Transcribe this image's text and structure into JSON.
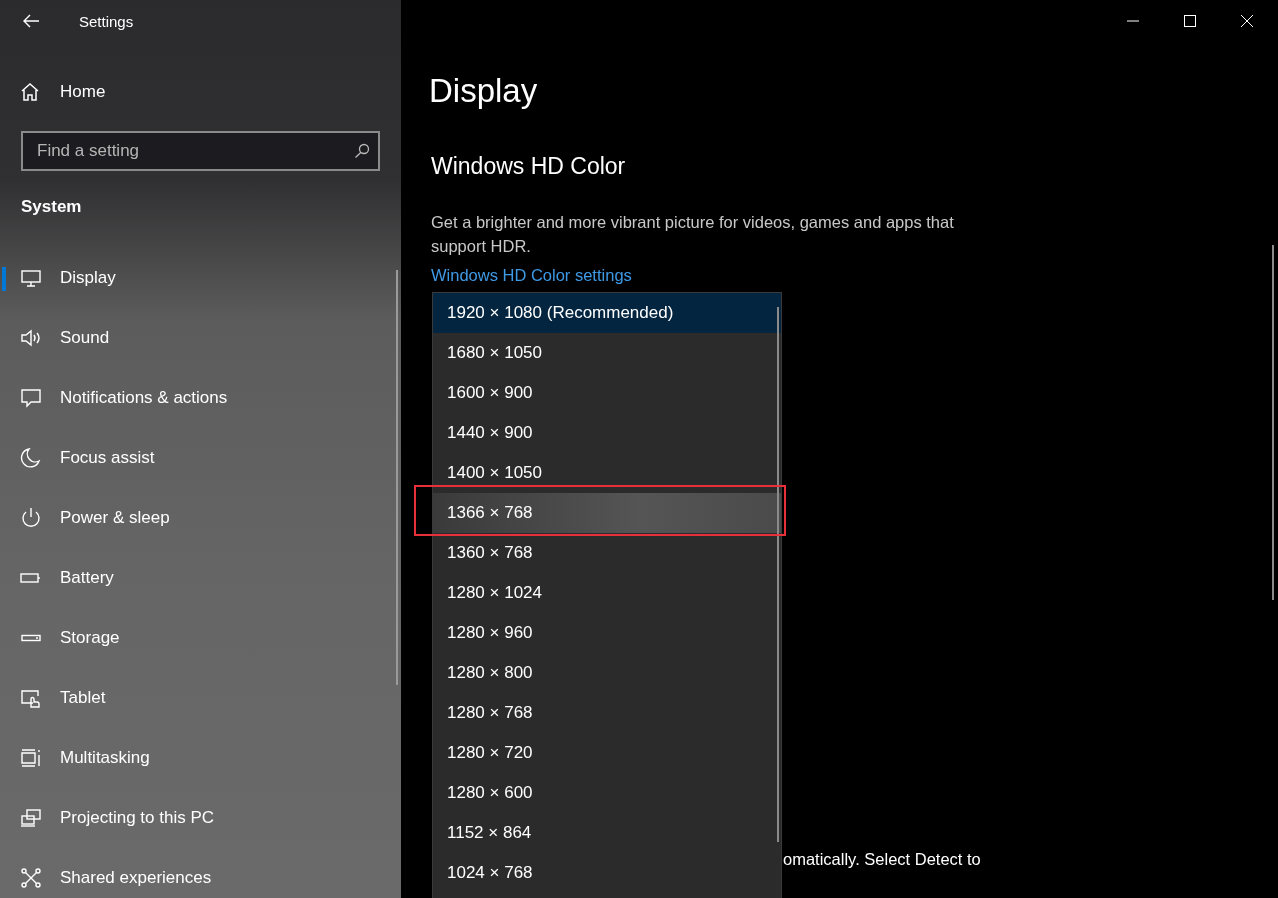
{
  "window": {
    "title": "Settings"
  },
  "sidebar": {
    "home": "Home",
    "search": {
      "placeholder": "Find a setting"
    },
    "section": "System",
    "items": [
      {
        "label": "Display",
        "selected": true
      },
      {
        "label": "Sound",
        "selected": false
      },
      {
        "label": "Notifications & actions",
        "selected": false
      },
      {
        "label": "Focus assist",
        "selected": false
      },
      {
        "label": "Power & sleep",
        "selected": false
      },
      {
        "label": "Battery",
        "selected": false
      },
      {
        "label": "Storage",
        "selected": false
      },
      {
        "label": "Tablet",
        "selected": false
      },
      {
        "label": "Multitasking",
        "selected": false
      },
      {
        "label": "Projecting to this PC",
        "selected": false
      },
      {
        "label": "Shared experiences",
        "selected": false
      }
    ]
  },
  "page": {
    "title": "Display",
    "section_title": "Windows HD Color",
    "description": "Get a brighter and more vibrant picture for videos, games and apps that support HDR.",
    "link": "Windows HD Color settings",
    "partial_text": "omatically. Select Detect to"
  },
  "resolution_dropdown": {
    "options": [
      {
        "label": "1920 × 1080 (Recommended)",
        "selected": true,
        "hovered": false,
        "annotated": false
      },
      {
        "label": "1680 × 1050",
        "selected": false,
        "hovered": false,
        "annotated": false
      },
      {
        "label": "1600 × 900",
        "selected": false,
        "hovered": false,
        "annotated": false
      },
      {
        "label": "1440 × 900",
        "selected": false,
        "hovered": false,
        "annotated": false
      },
      {
        "label": "1400 × 1050",
        "selected": false,
        "hovered": false,
        "annotated": false
      },
      {
        "label": "1366 × 768",
        "selected": false,
        "hovered": true,
        "annotated": true
      },
      {
        "label": "1360 × 768",
        "selected": false,
        "hovered": false,
        "annotated": false
      },
      {
        "label": "1280 × 1024",
        "selected": false,
        "hovered": false,
        "annotated": false
      },
      {
        "label": "1280 × 960",
        "selected": false,
        "hovered": false,
        "annotated": false
      },
      {
        "label": "1280 × 800",
        "selected": false,
        "hovered": false,
        "annotated": false
      },
      {
        "label": "1280 × 768",
        "selected": false,
        "hovered": false,
        "annotated": false
      },
      {
        "label": "1280 × 720",
        "selected": false,
        "hovered": false,
        "annotated": false
      },
      {
        "label": "1280 × 600",
        "selected": false,
        "hovered": false,
        "annotated": false
      },
      {
        "label": "1152 × 864",
        "selected": false,
        "hovered": false,
        "annotated": false
      },
      {
        "label": "1024 × 768",
        "selected": false,
        "hovered": false,
        "annotated": false
      }
    ]
  }
}
